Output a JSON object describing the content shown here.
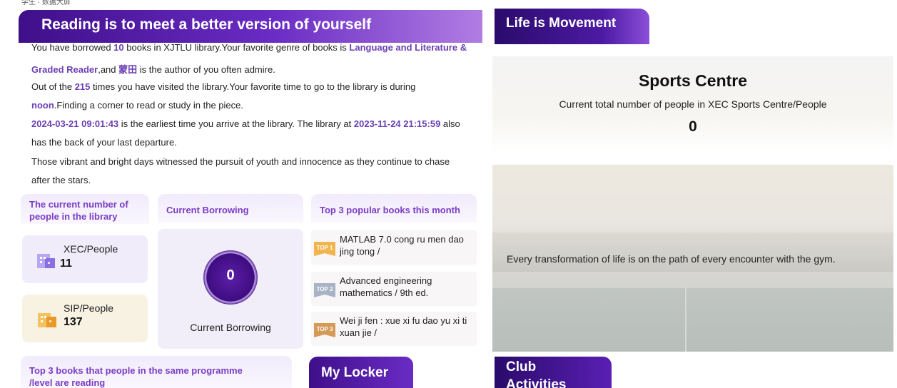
{
  "top_strip": {
    "text": "学生 · 数据大屏"
  },
  "reading": {
    "title": "Reading is to meet a better version of yourself",
    "line1_a": "You have borrowed ",
    "borrowed_count": "10",
    "line1_b": " books in XJTLU library.Your favorite genre of books is ",
    "genre_part1": "Language and Literature &",
    "genre_part2": "Graded Reader",
    "line2_a": ",and ",
    "favorite_author": "蒙田",
    "line2_b": " is the author of you often admire.",
    "line3_a": "Out of the ",
    "visit_count": "215",
    "line3_b": " times you have visited the library.Your favorite time to go to the library is during",
    "favorite_time": "noon",
    "line4_b": ".Finding a corner to read or study in the piece.",
    "earliest_time": "2024-03-21 09:01:43",
    "line5_b": " is the earliest time you arrive at the library. The library at ",
    "last_departure": "2023-11-24 21:15:59",
    "line5_c": " also",
    "line6": "has the back of your last departure.",
    "line7": "Those vibrant and bright days witnessed the pursuit of youth and innocence as they continue to chase",
    "line8": "after the stars."
  },
  "library_count": {
    "title": "The current number of people in the library",
    "xec_label": "XEC/People",
    "xec_value": "11",
    "sip_label": "SIP/People",
    "sip_value": "137"
  },
  "borrowing": {
    "title": "Current Borrowing",
    "value": "0",
    "caption": "Current Borrowing"
  },
  "popular": {
    "title": "Top 3 popular books this month",
    "books": [
      {
        "badge": "TOP 1",
        "title": "MATLAB 7.0 cong ru men dao jing tong /"
      },
      {
        "badge": "TOP 2",
        "title": "Advanced engineering mathematics / 9th ed."
      },
      {
        "badge": "TOP 3",
        "title": "Wei ji fen : xue xi fu dao yu xi ti xuan jie /"
      }
    ]
  },
  "programme": {
    "title": "Top 3 books that people in the same programme /level are reading"
  },
  "locker": {
    "title": "My Locker"
  },
  "life": {
    "title": "Life is Movement"
  },
  "sports": {
    "title": "Sports Centre",
    "subtitle": "Current total number of people in XEC Sports Centre/People",
    "value": "0"
  },
  "gym": {
    "quote": "Every transformation of life is on the path of every encounter with the gym."
  },
  "club": {
    "title": "Club Activities"
  },
  "colors": {
    "accent": "#6b3fb5",
    "banner": "#3f0f8a",
    "cream": "#f8f2e3",
    "lilac": "#f1ecfa"
  },
  "icons": [
    "building-icon",
    "building-icon"
  ]
}
